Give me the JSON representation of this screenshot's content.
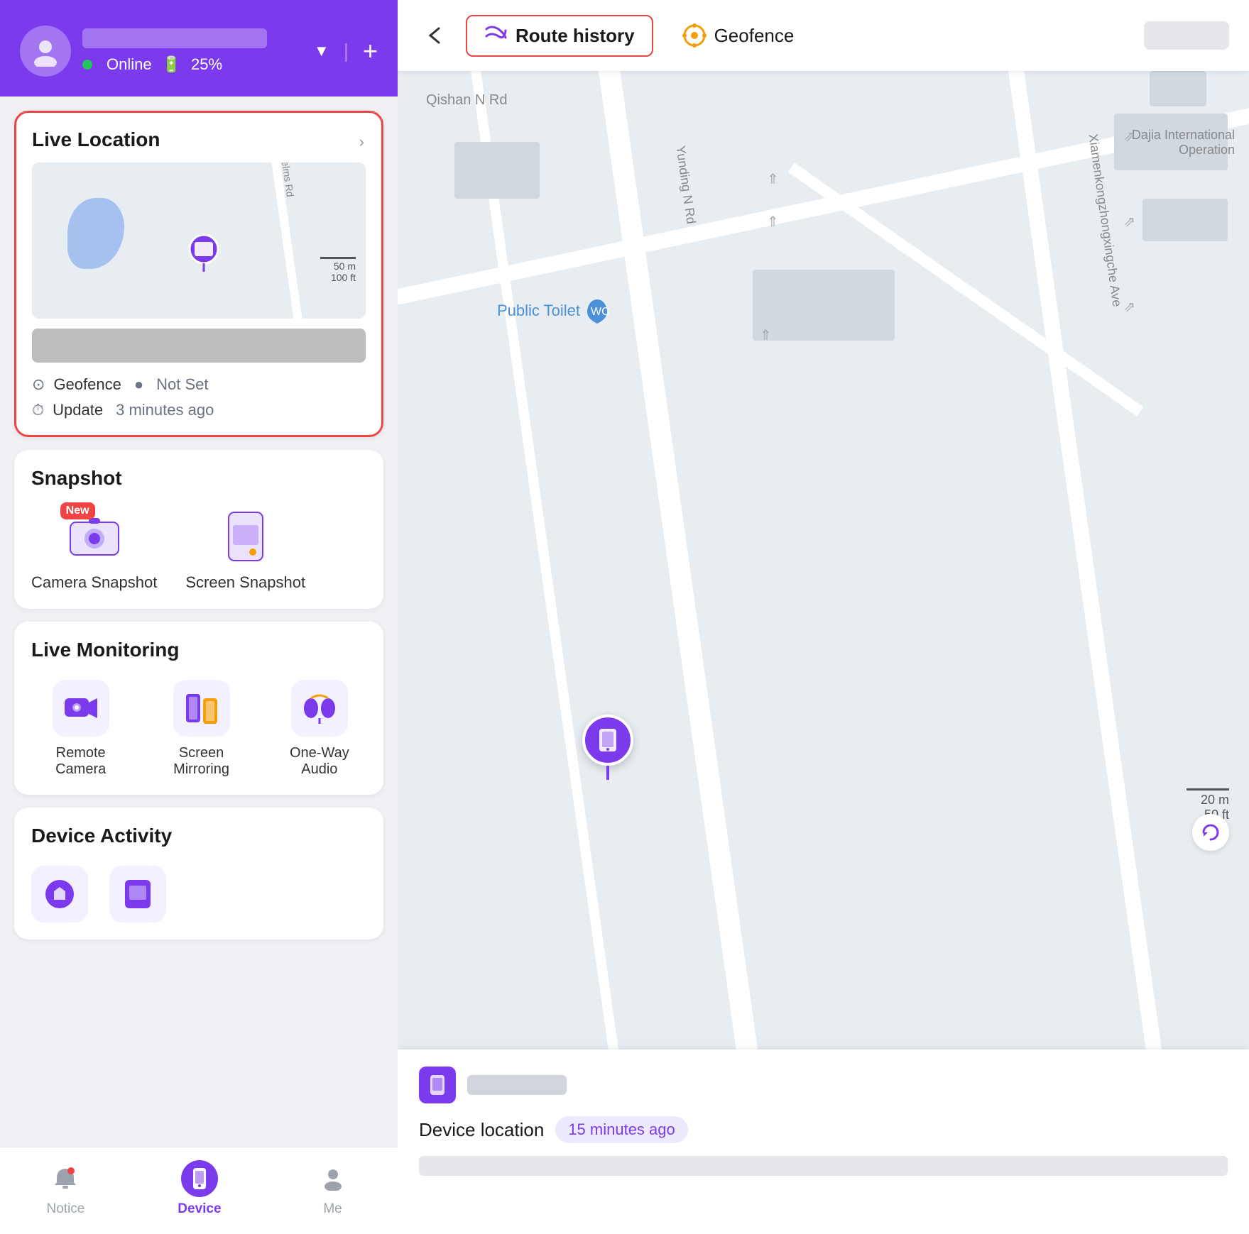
{
  "header": {
    "username_blur": true,
    "status": "Online",
    "battery_percent": "25%",
    "dropdown_label": "▼",
    "add_label": "+"
  },
  "live_location": {
    "title": "Live Location",
    "geofence_label": "Geofence",
    "geofence_value": "Not Set",
    "update_label": "Update",
    "update_value": "3 minutes ago",
    "map_road_label": "Helms Rd",
    "map_scale_50m": "50 m",
    "map_scale_100ft": "100 ft"
  },
  "snapshot": {
    "title": "Snapshot",
    "camera_label": "Camera Snapshot",
    "screen_label": "Screen Snapshot",
    "new_badge": "New"
  },
  "live_monitoring": {
    "title": "Live Monitoring",
    "items": [
      {
        "label": "Remote Camera"
      },
      {
        "label": "Screen Mirroring"
      },
      {
        "label": "One-Way Audio"
      }
    ]
  },
  "device_activity": {
    "title": "Device Activity"
  },
  "bottom_nav": {
    "items": [
      {
        "label": "Notice",
        "active": false
      },
      {
        "label": "Device",
        "active": true
      },
      {
        "label": "Me",
        "active": false
      }
    ]
  },
  "map_view": {
    "back_icon": "←",
    "route_history_label": "Route history",
    "geofence_label": "Geofence",
    "road_labels": [
      "Qishan N Rd",
      "Yunding N Rd",
      "Xiamenkongzhongxingche Ave"
    ],
    "poi_label": "Public Toilet",
    "device_location_label": "Device location",
    "time_ago": "15 minutes ago",
    "scale_20m": "20 m",
    "scale_50ft": "50 ft",
    "building_label": "Dajia International Operation"
  }
}
